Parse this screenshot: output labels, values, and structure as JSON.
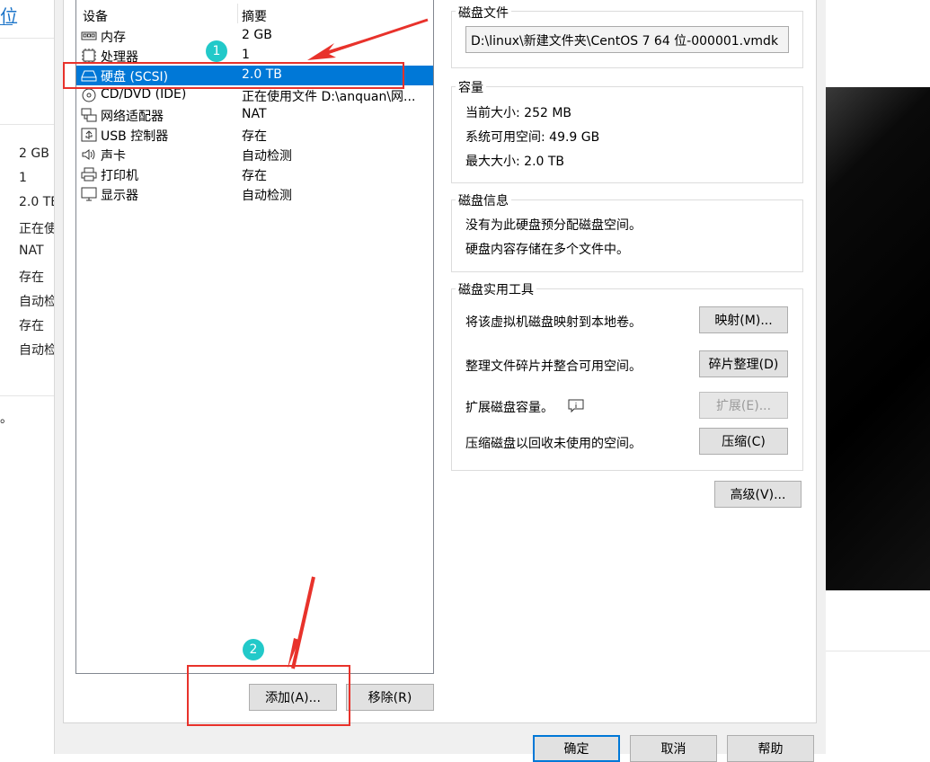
{
  "background": {
    "title_fragment": "位",
    "values": [
      "2 GB",
      "1",
      "2.0 TB",
      "正在使",
      "NAT",
      "存在",
      "自动检",
      "存在",
      "自动检"
    ],
    "tail": "。"
  },
  "devices": {
    "header": {
      "device": "设备",
      "summary": "摘要"
    },
    "items": [
      {
        "icon": "memory-icon",
        "name": "内存",
        "summary": "2 GB",
        "selected": false
      },
      {
        "icon": "cpu-icon",
        "name": "处理器",
        "summary": "1",
        "selected": false
      },
      {
        "icon": "hard-disk-icon",
        "name": "硬盘 (SCSI)",
        "summary": "2.0 TB",
        "selected": true
      },
      {
        "icon": "cd-dvd-icon",
        "name": "CD/DVD (IDE)",
        "summary": "正在使用文件 D:\\anquan\\网...",
        "selected": false
      },
      {
        "icon": "network-adapter-icon",
        "name": "网络适配器",
        "summary": "NAT",
        "selected": false
      },
      {
        "icon": "usb-icon",
        "name": "USB 控制器",
        "summary": "存在",
        "selected": false
      },
      {
        "icon": "sound-card-icon",
        "name": "声卡",
        "summary": "自动检测",
        "selected": false
      },
      {
        "icon": "printer-icon",
        "name": "打印机",
        "summary": "存在",
        "selected": false
      },
      {
        "icon": "display-icon",
        "name": "显示器",
        "summary": "自动检测",
        "selected": false
      }
    ],
    "add_button": "添加(A)...",
    "remove_button": "移除(R)"
  },
  "disk_file": {
    "title": "磁盘文件",
    "path": "D:\\linux\\新建文件夹\\CentOS 7 64 位-000001.vmdk"
  },
  "capacity": {
    "title": "容量",
    "current": "当前大小: 252 MB",
    "available": "系统可用空间: 49.9 GB",
    "max": "最大大小: 2.0 TB"
  },
  "disk_info": {
    "title": "磁盘信息",
    "line1": "没有为此硬盘预分配磁盘空间。",
    "line2": "硬盘内容存储在多个文件中。"
  },
  "utilities": {
    "title": "磁盘实用工具",
    "map_text": "将该虚拟机磁盘映射到本地卷。",
    "map_button": "映射(M)...",
    "defrag_text": "整理文件碎片并整合可用空间。",
    "defrag_button": "碎片整理(D)",
    "expand_text": "扩展磁盘容量。",
    "expand_button": "扩展(E)...",
    "compact_text": "压缩磁盘以回收未使用的空间。",
    "compact_button": "压缩(C)"
  },
  "advanced_button": "高级(V)...",
  "footer": {
    "ok": "确定",
    "cancel": "取消",
    "help": "帮助"
  },
  "annotations": {
    "badge1": "1",
    "badge2": "2"
  },
  "colors": {
    "selection": "#0078d7",
    "annotation_red": "#e8322b",
    "badge": "#22c9c9"
  }
}
